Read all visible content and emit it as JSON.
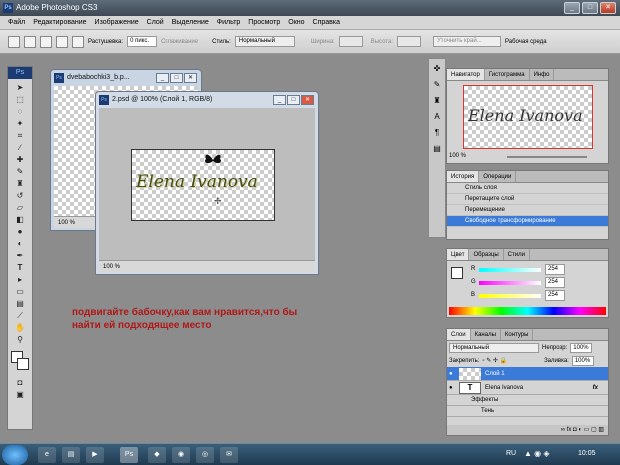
{
  "app": {
    "title": "Adobe Photoshop CS3",
    "icon": "Ps"
  },
  "menu": [
    "Файл",
    "Редактирование",
    "Изображение",
    "Слой",
    "Выделение",
    "Фильтр",
    "Просмотр",
    "Окно",
    "Справка"
  ],
  "options": {
    "feather_label": "Растушевка:",
    "feather_value": "0 пикс.",
    "antialias_label": "Сглаживание",
    "style_label": "Стиль:",
    "style_value": "Нормальный",
    "width_label": "Ширина:",
    "height_label": "Высота:",
    "refine_button": "Уточнить край...",
    "workspace_label": "Рабочая среда"
  },
  "doc_back": {
    "title": "dvebabochki3_b.p...",
    "zoom": "100 %"
  },
  "doc_front": {
    "title": "2.psd @ 100% (Слой 1, RGB/8)",
    "zoom": "100 %",
    "canvas_text": "Elena Ivanova"
  },
  "annotation": {
    "line1": "подвигайте бабочку,как вам нравится,что бы",
    "line2": "найти ей подходящее место"
  },
  "navigator": {
    "tabs": [
      "Навигатор",
      "Гистограмма",
      "Инфо"
    ],
    "zoom": "100 %",
    "thumb_text": "Elena Ivanova"
  },
  "history": {
    "tabs": [
      "История",
      "Операции"
    ],
    "items": [
      "Стиль слоя",
      "Перетащите слой",
      "Перемещение",
      "Свободное трансформирование"
    ]
  },
  "color": {
    "tabs": [
      "Цвет",
      "Образцы",
      "Стили"
    ],
    "r_label": "R",
    "g_label": "G",
    "b_label": "B",
    "r": "254",
    "g": "254",
    "b": "254",
    "r_level": 1.0,
    "g_level": 1.0,
    "b_level": 1.0
  },
  "layers": {
    "tabs": [
      "Слои",
      "Каналы",
      "Контуры"
    ],
    "blend": "Нормальный",
    "opacity_label": "Непрозр:",
    "opacity": "100%",
    "lock_label": "Закрепить:",
    "fill_label": "Заливка:",
    "fill": "100%",
    "rows": [
      "Слой 1",
      "Elena Ivanova",
      "Эффекты",
      "Тень"
    ],
    "fx_label": "fx"
  },
  "taskbar": {
    "lang": "RU",
    "time": "10:05"
  },
  "colors": {
    "accent": "#3b7ad6",
    "annotation": "#b01818"
  }
}
